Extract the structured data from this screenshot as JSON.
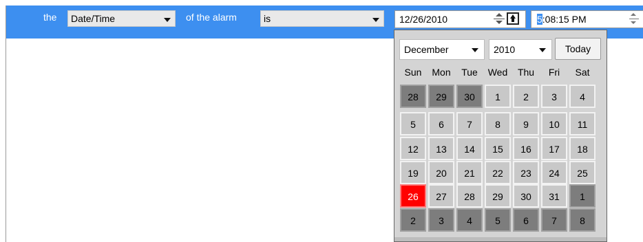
{
  "rule": {
    "prefix": "the",
    "field_select": "Date/Time",
    "middle_text": "of the alarm",
    "operator_select": "is",
    "date_value": "12/26/2010",
    "time_hour": "5",
    "time_rest": ":08:15 PM"
  },
  "calendar": {
    "month": "December",
    "year": "2010",
    "today_label": "Today",
    "weekdays": [
      "Sun",
      "Mon",
      "Tue",
      "Wed",
      "Thu",
      "Fri",
      "Sat"
    ],
    "weeks": [
      [
        "28",
        "29",
        "30",
        "1",
        "2",
        "3",
        "4"
      ],
      [
        "5",
        "6",
        "7",
        "8",
        "9",
        "10",
        "11"
      ],
      [
        "12",
        "13",
        "14",
        "15",
        "16",
        "17",
        "18"
      ],
      [
        "19",
        "20",
        "21",
        "22",
        "23",
        "24",
        "25"
      ],
      [
        "26",
        "27",
        "28",
        "29",
        "30",
        "31",
        "1"
      ],
      [
        "2",
        "3",
        "4",
        "5",
        "6",
        "7",
        "8"
      ]
    ],
    "selected_day": "26",
    "selected_color": "#ff0000",
    "accent_color": "#3d8ff0"
  }
}
